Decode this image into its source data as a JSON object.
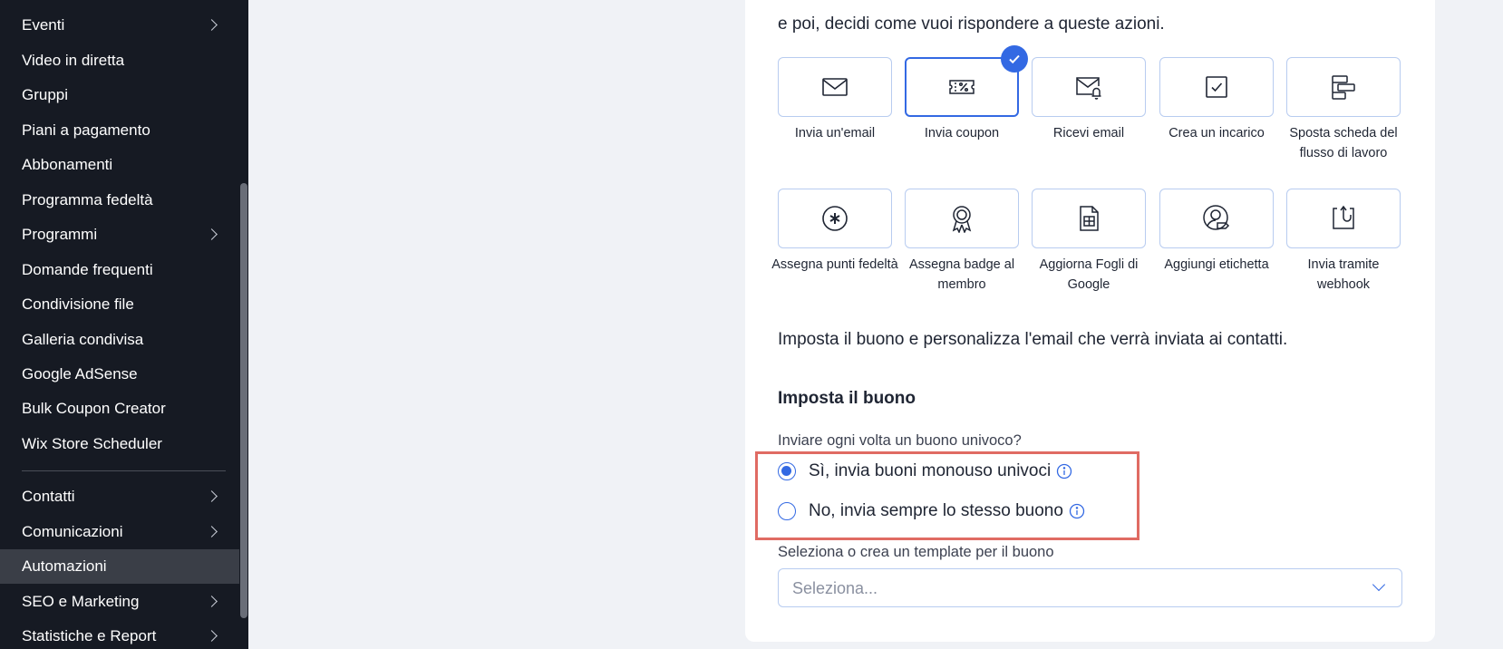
{
  "sidebar": {
    "items": [
      {
        "label": "Eventi",
        "has_submenu": true
      },
      {
        "label": "Video in diretta",
        "has_submenu": false
      },
      {
        "label": "Gruppi",
        "has_submenu": false
      },
      {
        "label": "Piani a pagamento",
        "has_submenu": false
      },
      {
        "label": "Abbonamenti",
        "has_submenu": false
      },
      {
        "label": "Programma fedeltà",
        "has_submenu": false
      },
      {
        "label": "Programmi",
        "has_submenu": true
      },
      {
        "label": "Domande frequenti",
        "has_submenu": false
      },
      {
        "label": "Condivisione file",
        "has_submenu": false
      },
      {
        "label": "Galleria condivisa",
        "has_submenu": false
      },
      {
        "label": "Google AdSense",
        "has_submenu": false
      },
      {
        "label": "Bulk Coupon Creator",
        "has_submenu": false
      },
      {
        "label": "Wix Store Scheduler",
        "has_submenu": false
      },
      {
        "label": "Contatti",
        "has_submenu": true
      },
      {
        "label": "Comunicazioni",
        "has_submenu": true
      },
      {
        "label": "Automazioni",
        "has_submenu": false,
        "active": true
      },
      {
        "label": "SEO e Marketing",
        "has_submenu": true
      },
      {
        "label": "Statistiche e Report",
        "has_submenu": true
      }
    ]
  },
  "main": {
    "intro": "e poi, decidi come vuoi rispondere a queste azioni.",
    "actions": [
      {
        "label": "Invia un'email",
        "icon": "envelope-icon"
      },
      {
        "label": "Invia coupon",
        "icon": "coupon-icon",
        "selected": true
      },
      {
        "label": "Ricevi email",
        "icon": "envelope-bell-icon"
      },
      {
        "label": "Crea un incarico",
        "icon": "task-checkbox-icon"
      },
      {
        "label": "Sposta scheda del flusso di lavoro",
        "icon": "workflow-card-icon"
      },
      {
        "label": "Assegna punti fedeltà",
        "icon": "loyalty-points-icon"
      },
      {
        "label": "Assegna badge al membro",
        "icon": "badge-ribbon-icon"
      },
      {
        "label": "Aggiorna Fogli di Google",
        "icon": "google-sheets-icon"
      },
      {
        "label": "Aggiungi etichetta",
        "icon": "user-tag-icon"
      },
      {
        "label": "Invia tramite webhook",
        "icon": "webhook-icon"
      }
    ],
    "subtitle": "Imposta il buono e personalizza l'email che verrà inviata ai contatti.",
    "section_title": "Imposta il buono",
    "question": "Inviare ogni volta un buono univoco?",
    "radio_options": [
      {
        "label": "Sì, invia buoni monouso univoci",
        "checked": true
      },
      {
        "label": "No, invia sempre lo stesso buono",
        "checked": false
      }
    ],
    "select_label": "Seleziona o crea un template per il buono",
    "select_placeholder": "Seleziona...",
    "accent_color": "#3369e3",
    "highlight_color": "#e06b63"
  }
}
